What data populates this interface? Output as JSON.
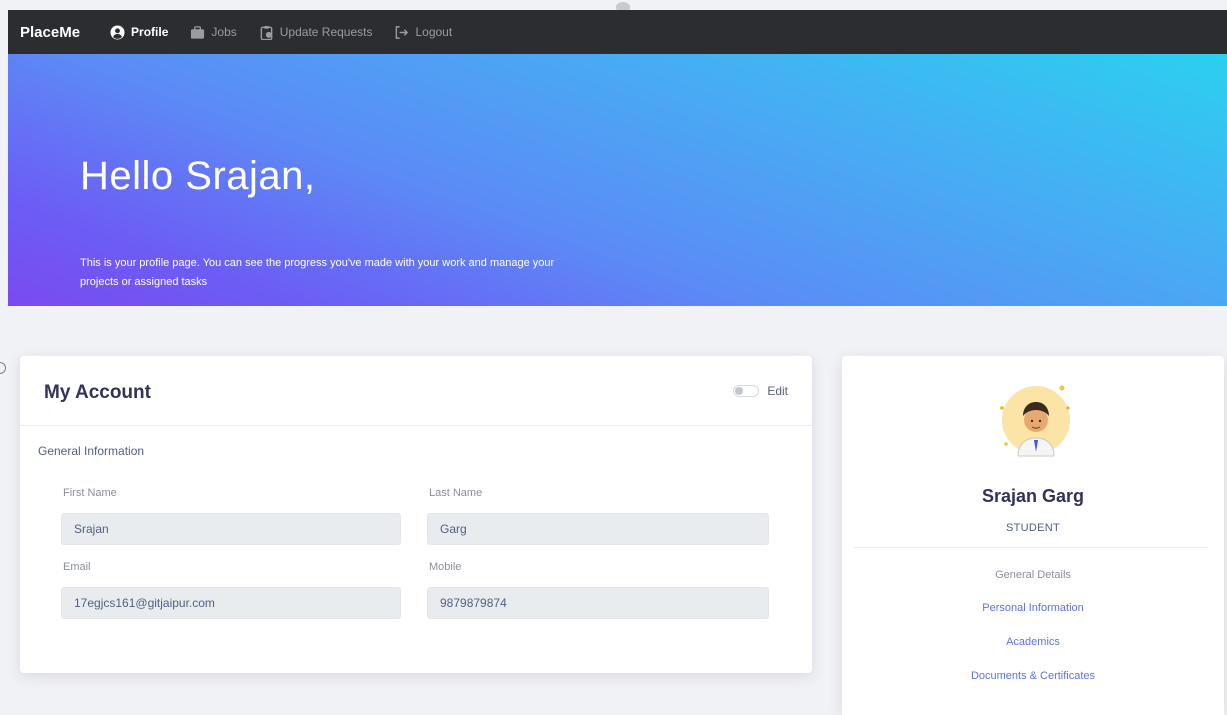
{
  "navbar": {
    "brand": "PlaceMe",
    "items": [
      {
        "label": "Profile",
        "icon": "user-circle-icon",
        "active": true
      },
      {
        "label": "Jobs",
        "icon": "briefcase-icon",
        "active": false
      },
      {
        "label": "Update Requests",
        "icon": "clipboard-icon",
        "active": false
      },
      {
        "label": "Logout",
        "icon": "logout-arrow-icon",
        "active": false
      }
    ]
  },
  "hero": {
    "title": "Hello Srajan,",
    "text": "This is your profile page. You can see the progress you've made with your work and manage your projects or assigned tasks"
  },
  "account": {
    "title": "My Account",
    "edit_label": "Edit",
    "section_label": "General Information",
    "fields": {
      "first_name": {
        "label": "First Name",
        "value": "Srajan"
      },
      "last_name": {
        "label": "Last Name",
        "value": "Garg"
      },
      "email": {
        "label": "Email",
        "value": "17egjcs161@gitjaipur.com"
      },
      "mobile": {
        "label": "Mobile",
        "value": "9879879874"
      }
    }
  },
  "profile": {
    "name": "Srajan Garg",
    "role": "STUDENT",
    "details_heading": "General Details",
    "links": [
      "Personal Information",
      "Academics",
      "Documents & Certificates"
    ]
  },
  "colors": {
    "navbar_bg": "#2b2d30",
    "hero_gradient_start": "#2bd0f0",
    "hero_gradient_end": "#7a4af0",
    "link": "#5e72e4",
    "input_bg": "#e9ecef"
  }
}
